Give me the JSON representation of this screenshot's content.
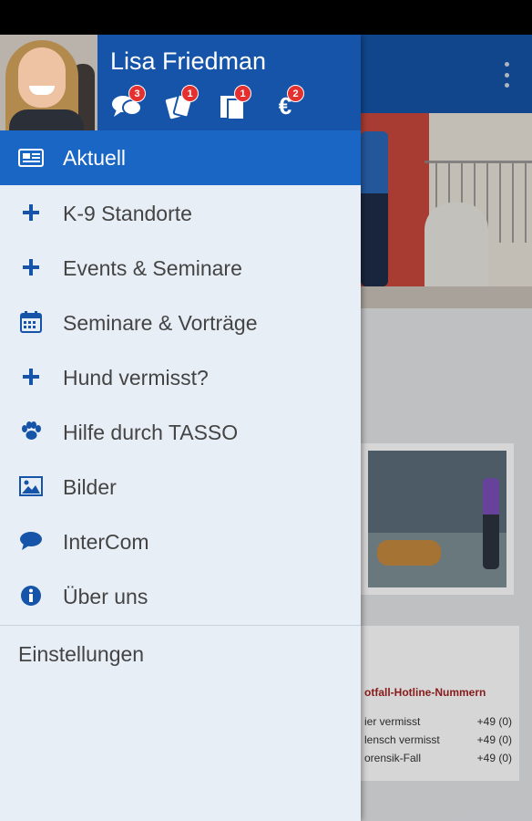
{
  "user": {
    "name": "Lisa Friedman"
  },
  "header_icons": [
    {
      "name": "messages-icon",
      "badge": "3"
    },
    {
      "name": "tickets-icon",
      "badge": "1"
    },
    {
      "name": "documents-icon",
      "badge": "1"
    },
    {
      "name": "euro-icon",
      "badge": "2"
    }
  ],
  "menu": {
    "items": [
      {
        "label": "Aktuell",
        "icon": "newspaper-icon",
        "active": true
      },
      {
        "label": "K-9 Standorte",
        "icon": "plus-icon"
      },
      {
        "label": "Events & Seminare",
        "icon": "plus-icon"
      },
      {
        "label": "Seminare & Vorträge",
        "icon": "calendar-icon"
      },
      {
        "label": "Hund vermisst?",
        "icon": "plus-icon"
      },
      {
        "label": "Hilfe durch TASSO",
        "icon": "paw-icon"
      },
      {
        "label": "Bilder",
        "icon": "image-icon"
      },
      {
        "label": "InterCom",
        "icon": "chat-icon"
      },
      {
        "label": "Über uns",
        "icon": "info-icon"
      }
    ],
    "settings_label": "Einstellungen"
  },
  "background": {
    "hotline_title": "otfall-Hotline-Nummern",
    "rows": [
      {
        "label": "ier  vermisst",
        "value": "+49 (0)"
      },
      {
        "label": "lensch  vermisst",
        "value": "+49 (0)"
      },
      {
        "label": "orensik-Fall",
        "value": "+49 (0)"
      }
    ]
  },
  "colors": {
    "primary": "#1554a8",
    "active": "#1a66c4",
    "drawer_bg": "#e8eef6",
    "badge": "#e53030"
  }
}
